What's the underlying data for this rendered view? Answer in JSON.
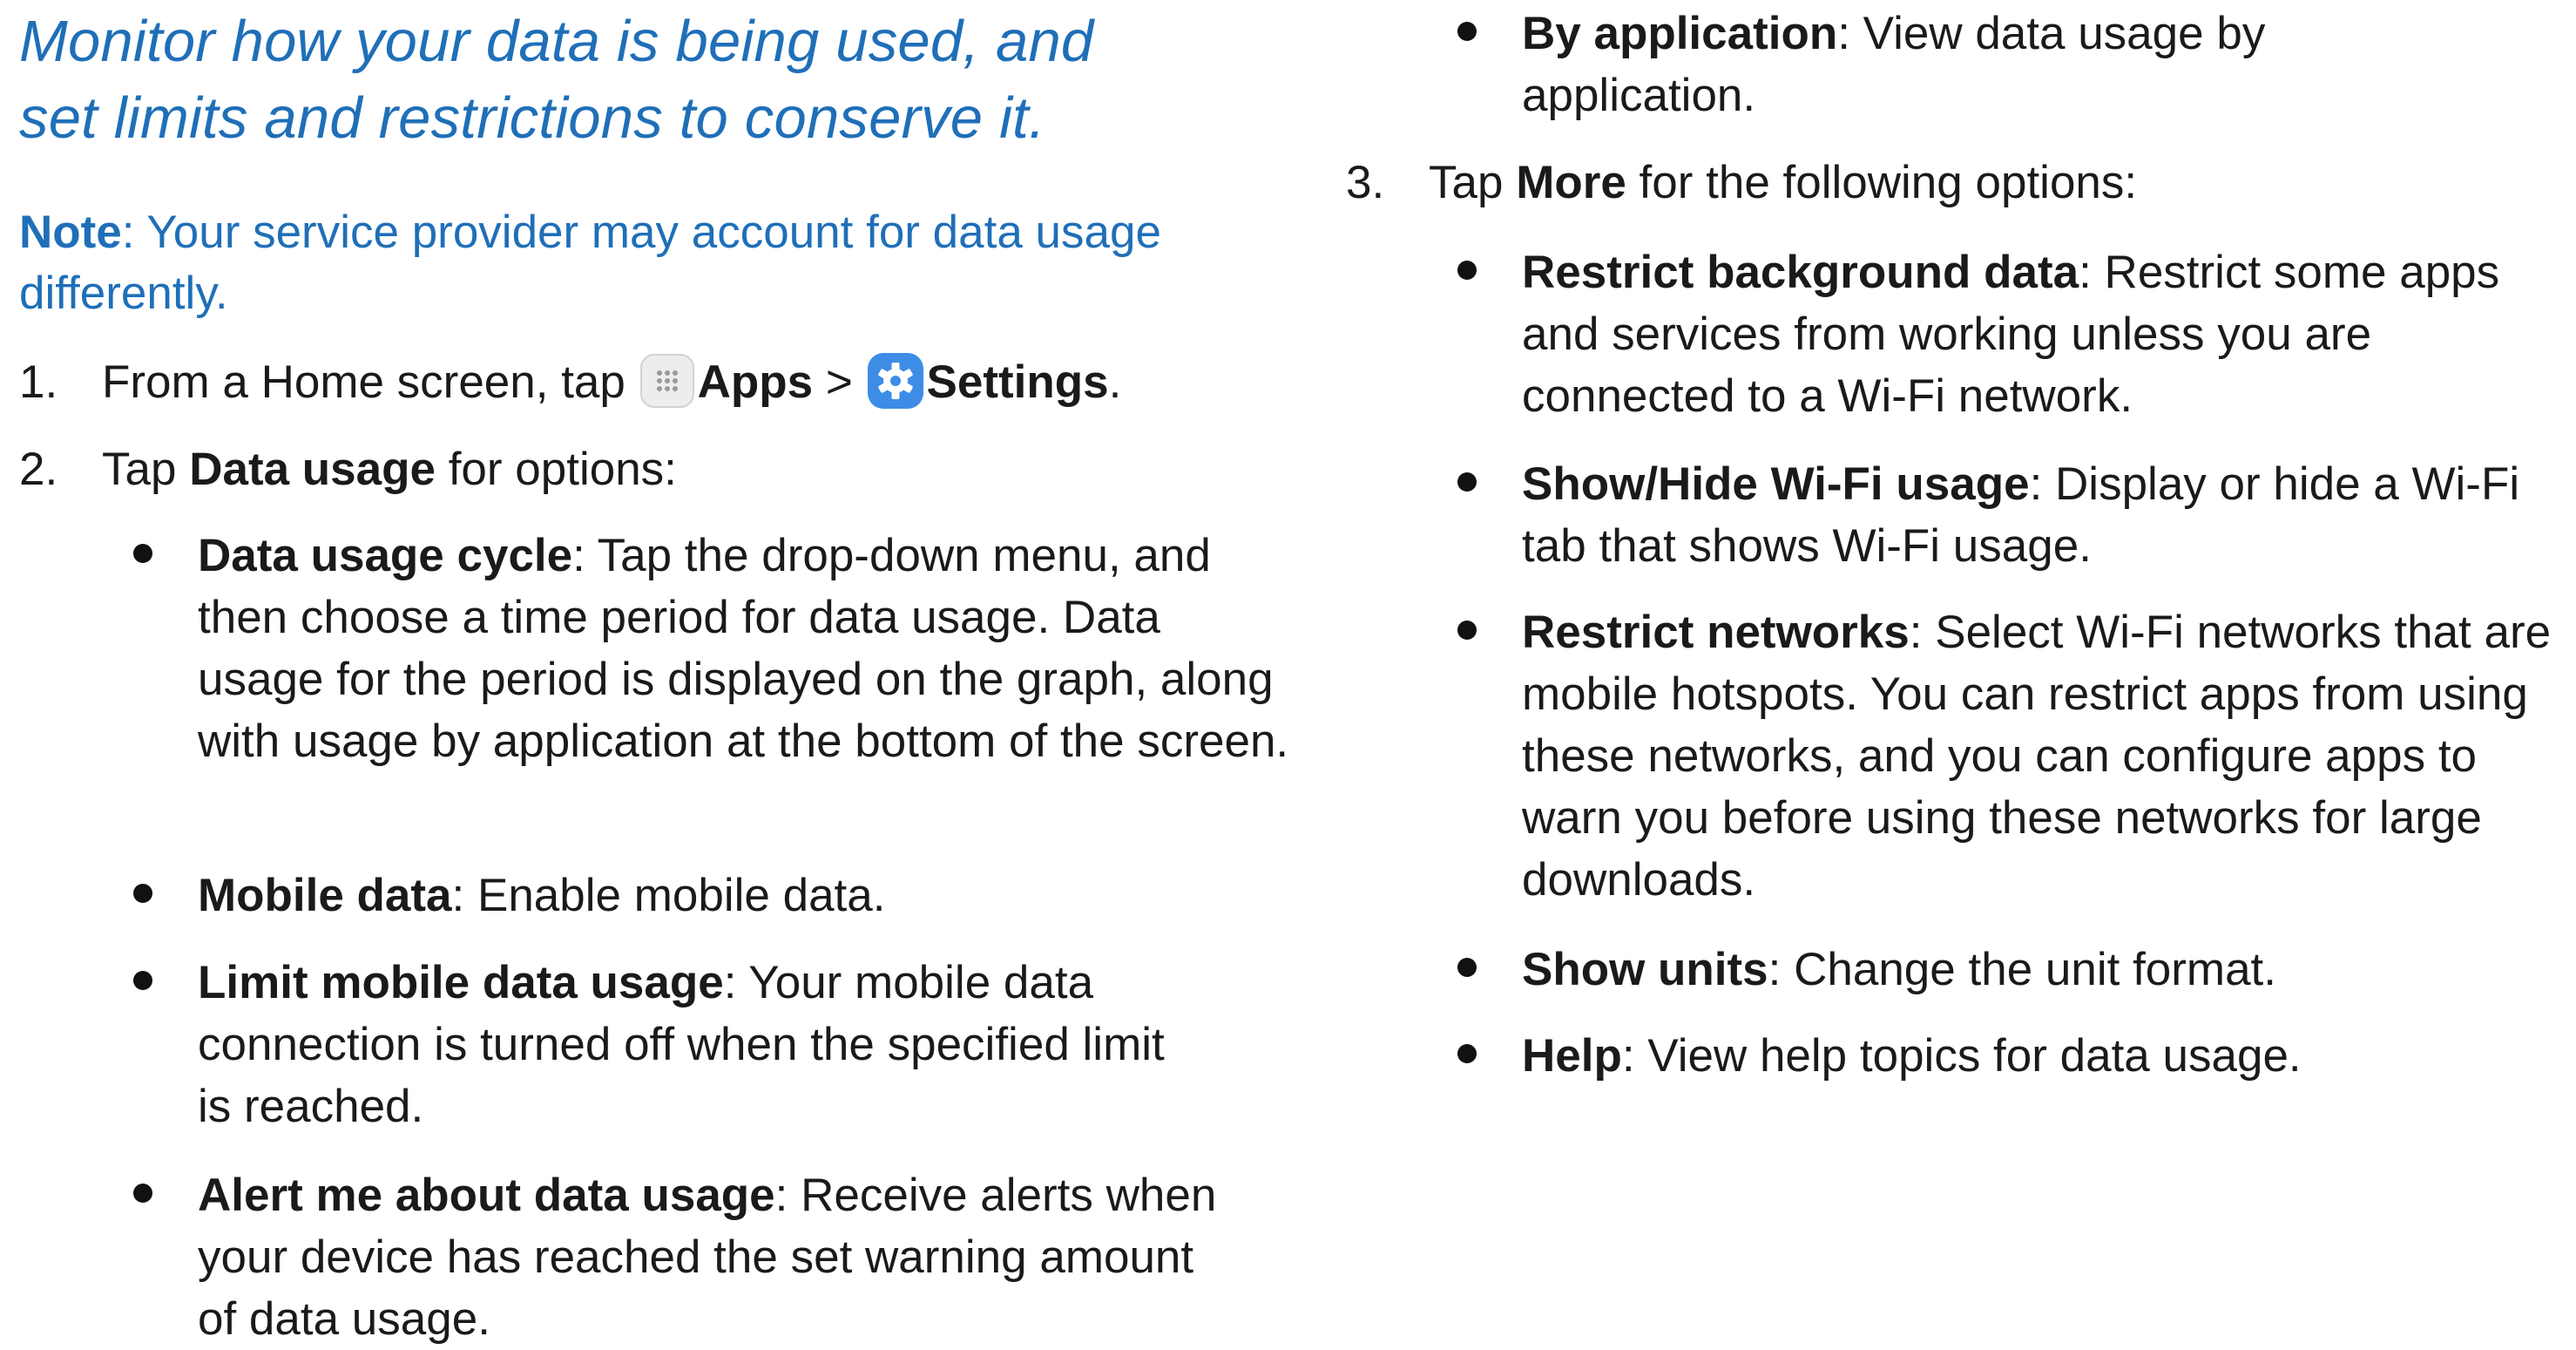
{
  "intro": {
    "line1": "Monitor how your data is being used, and",
    "line2": "set limits and restrictions to conserve it."
  },
  "note": {
    "label": "Note",
    "text": ": Your service provider may account for data usage differently."
  },
  "steps": [
    {
      "num": "1.",
      "pre": "From a Home screen, tap ",
      "apps": "Apps",
      "sep": " > ",
      "settings": "Settings",
      "post": "."
    },
    {
      "num": "2.",
      "pre": "Tap ",
      "bold": "Data usage",
      "post": " for options:"
    },
    {
      "num": "3.",
      "pre": "Tap ",
      "bold": "More",
      "post": " for the following options:"
    }
  ],
  "data_usage_options": [
    {
      "term": "Data usage cycle",
      "desc": ": Tap the drop-down menu, and then choose a time period for data usage. Data usage for the period is displayed on the graph, along with usage by application at the bottom of the screen."
    },
    {
      "term": "Mobile data",
      "desc": ": Enable mobile data."
    },
    {
      "term": "Limit mobile data usage",
      "desc": ": Your mobile data connection is turned off when the specified limit is reached."
    },
    {
      "term": "Alert me about data usage",
      "desc": ": Receive alerts when your device has reached the set warning amount of data usage."
    },
    {
      "term": "By application",
      "desc": ": View data usage by application."
    }
  ],
  "more_options": [
    {
      "term": "Restrict background data",
      "desc": ": Restrict some apps and services from working unless you are connected to a Wi-Fi network."
    },
    {
      "term": "Show/Hide Wi-Fi usage",
      "desc": ": Display or hide a Wi-Fi tab that shows Wi-Fi usage."
    },
    {
      "term": "Restrict networks",
      "desc": ": Select Wi-Fi networks that are mobile hotspots. You can restrict apps from using these networks, and you can configure apps to warn you before using these networks for large downloads."
    },
    {
      "term": "Show units",
      "desc": ": Change the unit format."
    },
    {
      "term": "Help",
      "desc": ": View help topics for data usage."
    }
  ],
  "colors": {
    "accent": "#1f6fb8",
    "text": "#1a1a1a",
    "settings_icon": "#3d8de6"
  },
  "icons": {
    "apps": "apps-grid-icon",
    "settings": "settings-gear-icon"
  }
}
